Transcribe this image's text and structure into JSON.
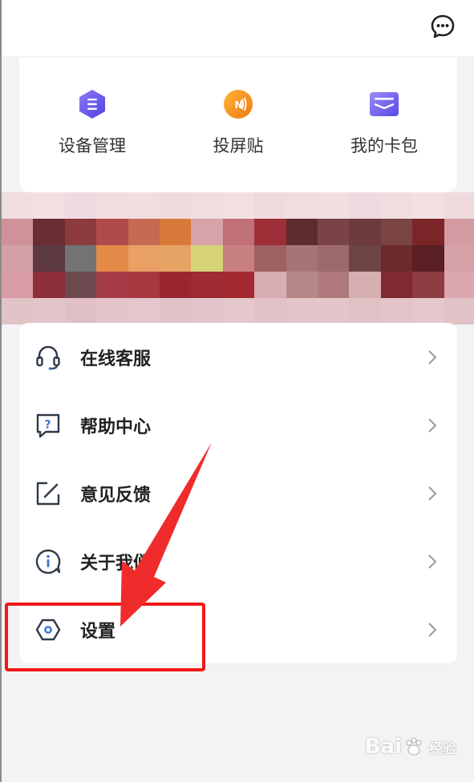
{
  "topbar": {
    "chat_icon": "chat-bubble-icon"
  },
  "tools": [
    {
      "label": "设备管理",
      "icon": "device-hexagon-icon",
      "color": "#6b5cf0"
    },
    {
      "label": "投屏贴",
      "icon": "nfc-screen-icon",
      "color": "#f39a18"
    },
    {
      "label": "我的卡包",
      "icon": "card-wallet-icon",
      "color": "#7b6cf2"
    }
  ],
  "menu": {
    "items": [
      {
        "label": "在线客服",
        "icon": "headset-icon"
      },
      {
        "label": "帮助中心",
        "icon": "help-question-icon"
      },
      {
        "label": "意见反馈",
        "icon": "feedback-edit-icon"
      },
      {
        "label": "关于我们",
        "icon": "info-icon"
      },
      {
        "label": "设置",
        "icon": "settings-hexagon-icon"
      }
    ]
  },
  "annotation": {
    "highlight_color": "#f01818",
    "target": "设置"
  },
  "watermark": {
    "text": "Bai",
    "suffix": "经验"
  }
}
